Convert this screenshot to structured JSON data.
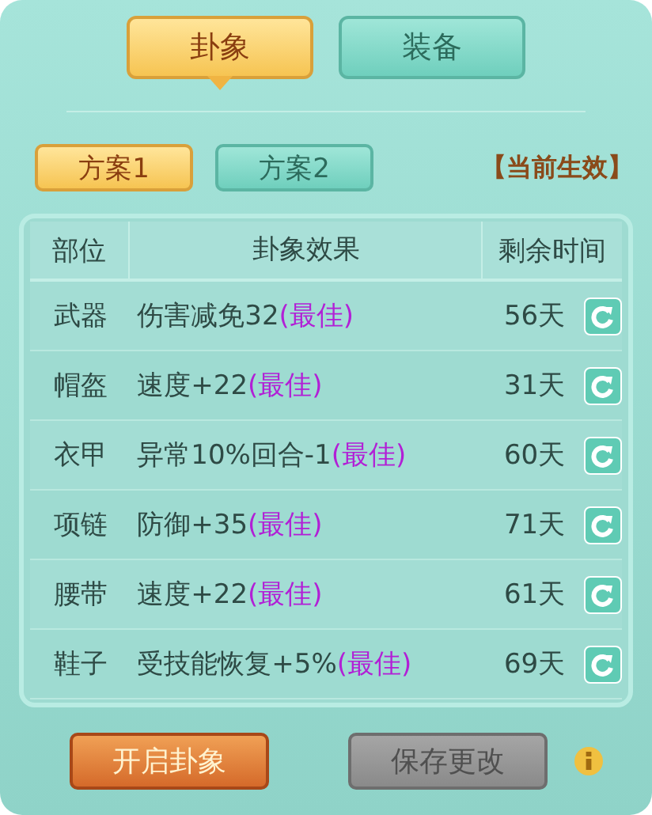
{
  "tabs": [
    {
      "label": "卦象",
      "selected": true
    },
    {
      "label": "装备",
      "selected": false
    }
  ],
  "plans": [
    {
      "label": "方案1",
      "selected": true
    },
    {
      "label": "方案2",
      "selected": false
    }
  ],
  "status": "【当前生效】",
  "table": {
    "columns": [
      "部位",
      "卦象效果",
      "剩余时间"
    ],
    "rows": [
      {
        "slot": "武器",
        "effect": "伤害减免32",
        "tag": "(最佳)",
        "remaining": "56天"
      },
      {
        "slot": "帽盔",
        "effect": "速度+22",
        "tag": "(最佳)",
        "remaining": "31天"
      },
      {
        "slot": "衣甲",
        "effect": "异常10%回合-1",
        "tag": "(最佳)",
        "remaining": "60天"
      },
      {
        "slot": "项链",
        "effect": "防御+35",
        "tag": "(最佳)",
        "remaining": "71天"
      },
      {
        "slot": "腰带",
        "effect": "速度+22",
        "tag": "(最佳)",
        "remaining": "61天"
      },
      {
        "slot": "鞋子",
        "effect": "受技能恢复+5%",
        "tag": "(最佳)",
        "remaining": "69天"
      }
    ]
  },
  "buttons": [
    {
      "label": "开启卦象",
      "disabled": false
    },
    {
      "label": "保存更改",
      "disabled": true
    }
  ]
}
